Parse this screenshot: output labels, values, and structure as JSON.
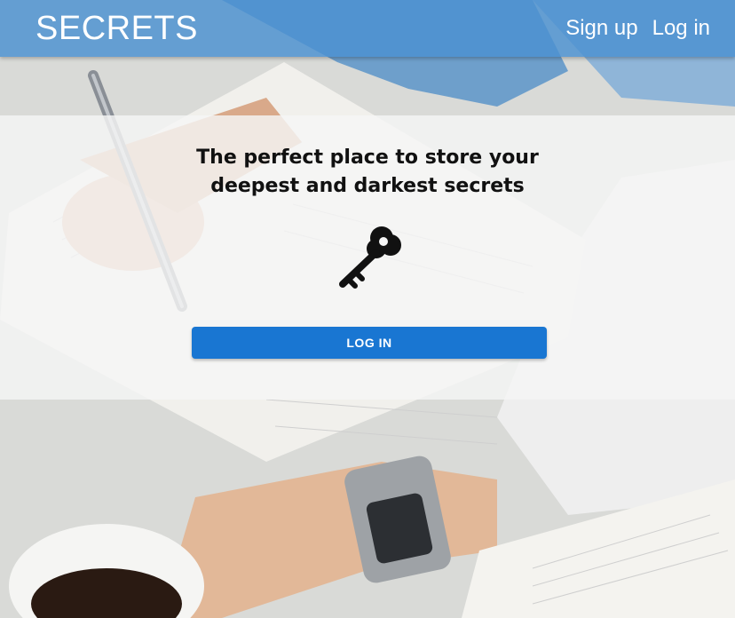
{
  "header": {
    "brand": "SECRETS",
    "nav": {
      "signup_label": "Sign up",
      "login_label": "Log in"
    }
  },
  "hero": {
    "tagline_line1": "The perfect place to store your",
    "tagline_line2": "deepest and darkest secrets",
    "icon": "key-icon",
    "login_button_label": "LOG IN"
  },
  "colors": {
    "header_bg": "#4a90d1",
    "button_bg": "#1976d2",
    "text_dark": "#111111"
  }
}
